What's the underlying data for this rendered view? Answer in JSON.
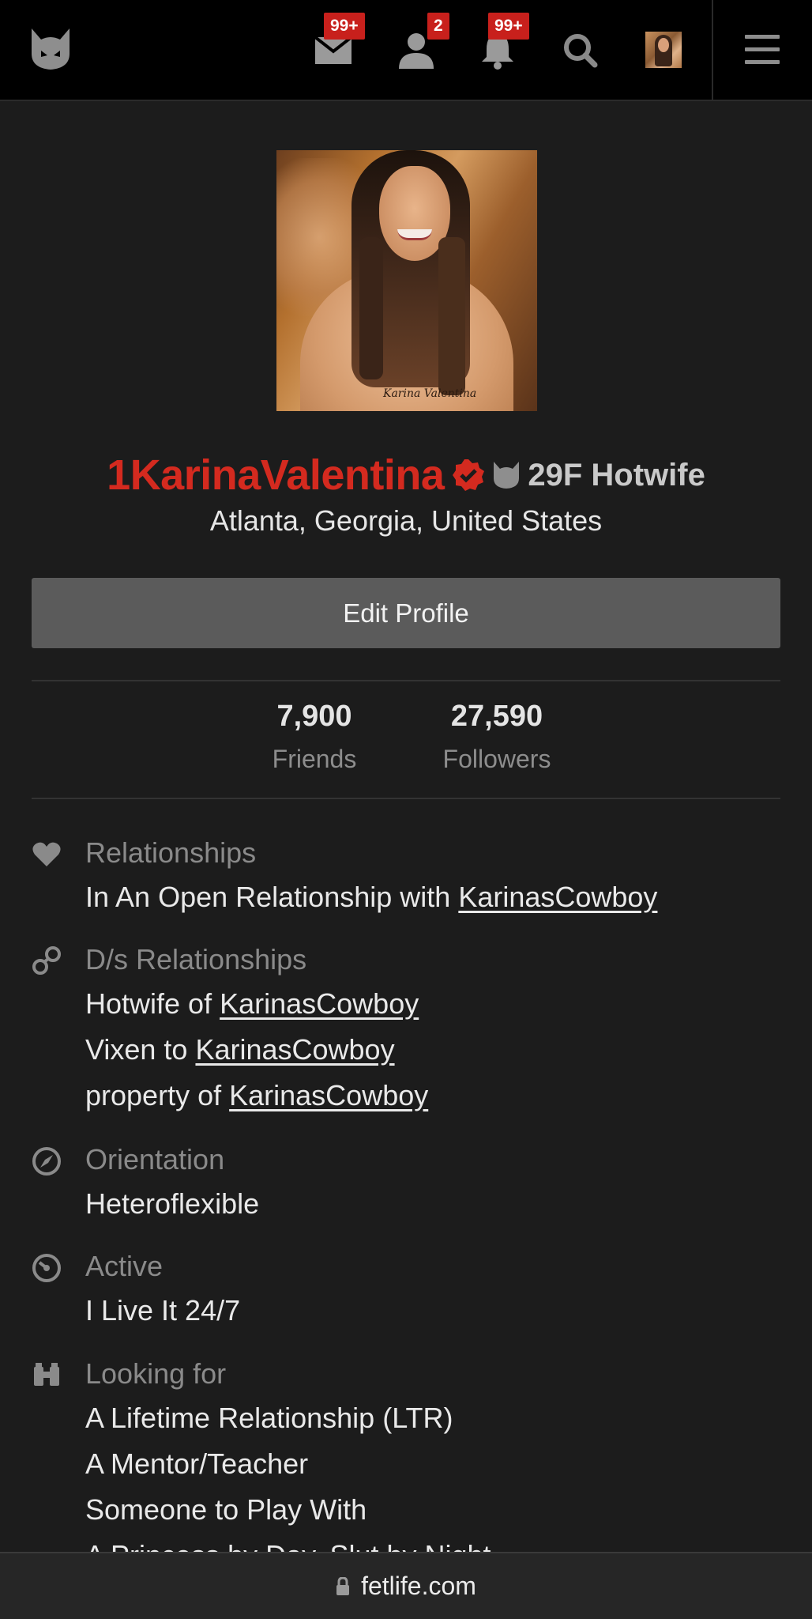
{
  "nav": {
    "logo_icon": "fetlife-cat-logo-icon",
    "messages_badge": "99+",
    "friend_requests_badge": "2",
    "notifications_badge": "99+",
    "badge_color": "#c8201c"
  },
  "profile": {
    "photo_signature": "Karina Valentina",
    "username": "1KarinaValentina",
    "age_sex_role": "29F Hotwife",
    "location": "Atlanta, Georgia, United States",
    "username_color": "#d42a1f"
  },
  "actions": {
    "edit_profile_label": "Edit Profile"
  },
  "stats": {
    "friends_count": "7,900",
    "friends_label": "Friends",
    "followers_count": "27,590",
    "followers_label": "Followers"
  },
  "sections": {
    "relationships": {
      "title": "Relationships",
      "line1_prefix": "In An Open Relationship with",
      "line1_link": "KarinasCowboy"
    },
    "ds": {
      "title": "D/s Relationships",
      "l1_prefix": "Hotwife of",
      "l1_link": "KarinasCowboy",
      "l2_prefix": "Vixen to",
      "l2_link": "KarinasCowboy",
      "l3_prefix": "property of",
      "l3_link": "KarinasCowboy"
    },
    "orientation": {
      "title": "Orientation",
      "value": "Heteroflexible"
    },
    "active": {
      "title": "Active",
      "value": "I Live It 24/7"
    },
    "looking": {
      "title": "Looking for",
      "v1": "A Lifetime Relationship (LTR)",
      "v2": "A Mentor/Teacher",
      "v3": "Someone to Play With",
      "v4": "A Princess by Day, Slut by Night"
    }
  },
  "browser": {
    "url": "fetlife.com"
  }
}
